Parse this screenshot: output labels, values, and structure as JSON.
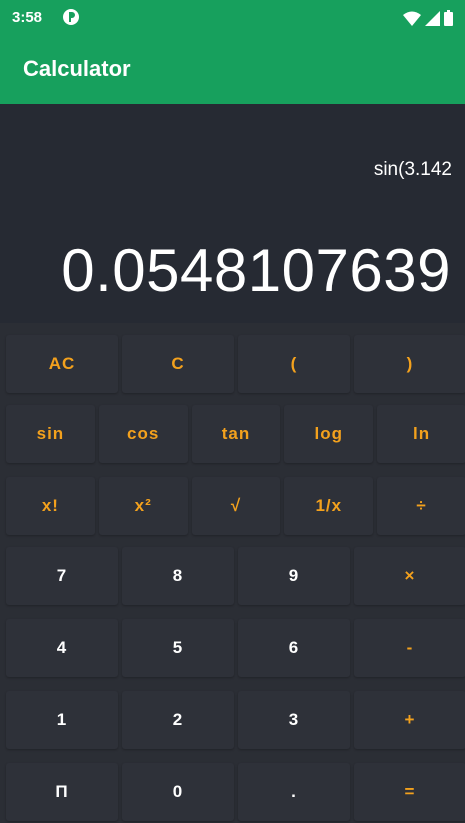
{
  "status": {
    "time": "3:58"
  },
  "app": {
    "title": "Calculator"
  },
  "display": {
    "expression": "sin(3.142",
    "result": "0.0548107639"
  },
  "keypad": {
    "rows": [
      [
        {
          "label": "AC",
          "accent": true
        },
        {
          "label": "C",
          "accent": true
        },
        {
          "label": "(",
          "accent": true
        },
        {
          "label": ")",
          "accent": true
        }
      ],
      [
        {
          "label": "sin",
          "accent": true
        },
        {
          "label": "cos",
          "accent": true
        },
        {
          "label": "tan",
          "accent": true
        },
        {
          "label": "log",
          "accent": true
        },
        {
          "label": "ln",
          "accent": true
        }
      ],
      [
        {
          "label": "x!",
          "accent": true
        },
        {
          "label": "x²",
          "accent": true
        },
        {
          "label": "√",
          "accent": true
        },
        {
          "label": "1/x",
          "accent": true
        },
        {
          "label": "÷",
          "accent": true
        }
      ],
      [
        {
          "label": "7",
          "accent": false
        },
        {
          "label": "8",
          "accent": false
        },
        {
          "label": "9",
          "accent": false
        },
        {
          "label": "×",
          "accent": true
        }
      ],
      [
        {
          "label": "4",
          "accent": false
        },
        {
          "label": "5",
          "accent": false
        },
        {
          "label": "6",
          "accent": false
        },
        {
          "label": "-",
          "accent": true
        }
      ],
      [
        {
          "label": "1",
          "accent": false
        },
        {
          "label": "2",
          "accent": false
        },
        {
          "label": "3",
          "accent": false
        },
        {
          "label": "+",
          "accent": true
        }
      ],
      [
        {
          "label": "Π",
          "accent": false
        },
        {
          "label": "0",
          "accent": false
        },
        {
          "label": ".",
          "accent": false
        },
        {
          "label": "=",
          "accent": true
        }
      ]
    ]
  },
  "colors": {
    "appbar": "#17a05d",
    "display": "#262a33",
    "keypad": "#2b2e35",
    "accent": "#f3a11d"
  }
}
